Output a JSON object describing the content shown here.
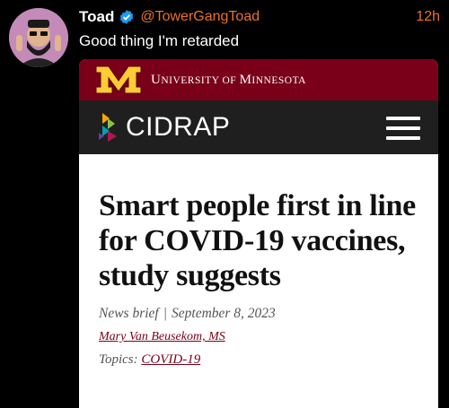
{
  "tweet": {
    "display_name": "Toad",
    "handle": "@TowerGangToad",
    "time": "12h",
    "text": "Good thing I'm retarded",
    "verified_icon": "verified-badge-icon"
  },
  "card": {
    "institution": {
      "logo_letter": "M",
      "name_parts": [
        "U",
        "NIVERSITY OF ",
        "M",
        "INNESOTA"
      ]
    },
    "site": {
      "name": "CIDRAP",
      "menu_icon": "hamburger-menu-icon"
    },
    "article": {
      "headline": "Smart people first in line for COVID-19 vaccines, study suggests",
      "type": "News brief",
      "separator": "|",
      "date": "September 8, 2023",
      "author": "Mary Van Beusekom, MS",
      "topics_label": "Topics:",
      "topic": "COVID-19"
    }
  },
  "colors": {
    "background": "#000000",
    "accent": "#e8702a",
    "umn_maroon": "#7a0019",
    "umn_gold": "#ffcc33",
    "cidrap_bar": "#1f1f1f"
  }
}
